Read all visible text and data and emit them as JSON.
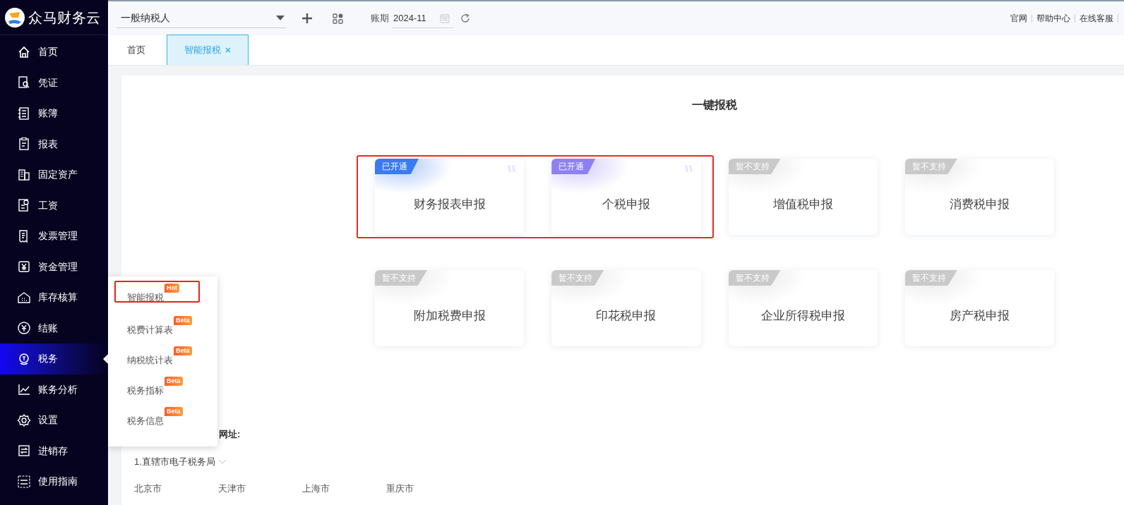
{
  "brand": {
    "name": "众马财务云"
  },
  "toolbar": {
    "taxpayer_type": "一般纳税人",
    "period_label": "账期",
    "period": "2024-11",
    "links": [
      "官网",
      "帮助中心",
      "在线客服"
    ]
  },
  "tabs": [
    {
      "label": "首页",
      "selected": false,
      "closable": false
    },
    {
      "label": "智能报税",
      "selected": true,
      "closable": true
    }
  ],
  "sidebar": {
    "items": [
      {
        "label": "首页",
        "selected": false
      },
      {
        "label": "凭证",
        "selected": false
      },
      {
        "label": "账簿",
        "selected": false
      },
      {
        "label": "报表",
        "selected": false
      },
      {
        "label": "固定资产",
        "selected": false
      },
      {
        "label": "工资",
        "selected": false
      },
      {
        "label": "发票管理",
        "selected": false
      },
      {
        "label": "资金管理",
        "selected": false
      },
      {
        "label": "库存核算",
        "selected": false
      },
      {
        "label": "结账",
        "selected": false
      },
      {
        "label": "税务",
        "selected": true
      },
      {
        "label": "账务分析",
        "selected": false
      },
      {
        "label": "设置",
        "selected": false
      },
      {
        "label": "进销存",
        "selected": false
      },
      {
        "label": "使用指南",
        "selected": false
      }
    ]
  },
  "submenu": {
    "items": [
      {
        "label": "智能报税",
        "badge": "Hot",
        "selected": true
      },
      {
        "label": "税费计算表",
        "badge": "Beta",
        "selected": false
      },
      {
        "label": "纳税统计表",
        "badge": "Beta",
        "selected": false
      },
      {
        "label": "税务指标",
        "badge": "Beta",
        "selected": false
      },
      {
        "label": "税务信息",
        "badge": "Beta",
        "selected": false
      }
    ]
  },
  "main": {
    "title": "一键报税",
    "cards": [
      {
        "label": "财务报表申报",
        "badge": "已开通",
        "kind": "enabled",
        "color": "#3b7bf0",
        "highlighted": true
      },
      {
        "label": "个税申报",
        "badge": "已开通",
        "kind": "enabled",
        "color": "#8f80f2",
        "highlighted": true
      },
      {
        "label": "增值税申报",
        "badge": "暂不支持",
        "kind": "unsupported",
        "color": "#c9c9c9",
        "highlighted": false
      },
      {
        "label": "消费税申报",
        "badge": "暂不支持",
        "kind": "unsupported",
        "color": "#c9c9c9",
        "highlighted": false
      },
      {
        "label": "附加税费申报",
        "badge": "暂不支持",
        "kind": "unsupported",
        "color": "#c9c9c9",
        "highlighted": false
      },
      {
        "label": "印花税申报",
        "badge": "暂不支持",
        "kind": "unsupported",
        "color": "#c9c9c9",
        "highlighted": false
      },
      {
        "label": "企业所得税申报",
        "badge": "暂不支持",
        "kind": "unsupported",
        "color": "#c9c9c9",
        "highlighted": false
      },
      {
        "label": "房产税申报",
        "badge": "暂不支持",
        "kind": "unsupported",
        "color": "#c9c9c9",
        "highlighted": false
      }
    ],
    "section_label": "网址:",
    "group": {
      "label": "1.直辖市电子税务局",
      "expanded": false
    },
    "cities": [
      "北京市",
      "天津市",
      "上海市",
      "重庆市"
    ]
  }
}
